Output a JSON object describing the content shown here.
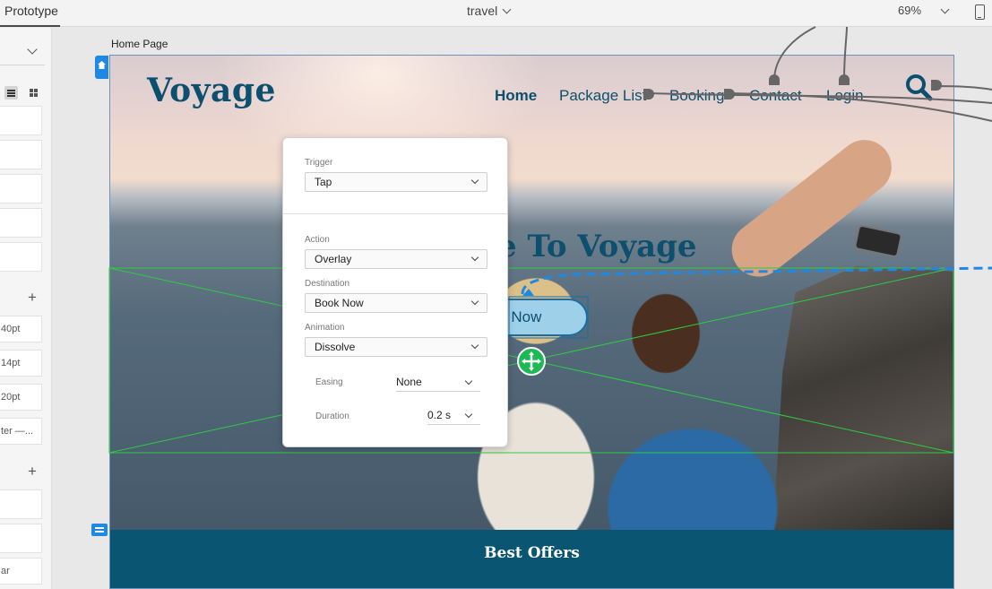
{
  "toolbar": {
    "mode": "Prototype",
    "document_title": "travel",
    "zoom": "69%",
    "device_icon": "mobile-device-icon"
  },
  "left_panel": {
    "field_values": [
      "40pt",
      "14pt",
      "20pt",
      "ter —...",
      "ar"
    ]
  },
  "canvas": {
    "artboard_label": "Home Page"
  },
  "site": {
    "logo": "Voyage",
    "nav": [
      "Home",
      "Package List",
      "Booking",
      "Contact",
      "Login"
    ],
    "hero_title": "e To Voyage",
    "book_button": "ok Now",
    "offers_heading": "Best Offers"
  },
  "interaction": {
    "trigger_label": "Trigger",
    "trigger_value": "Tap",
    "action_label": "Action",
    "action_value": "Overlay",
    "destination_label": "Destination",
    "destination_value": "Book Now",
    "animation_label": "Animation",
    "animation_value": "Dissolve",
    "easing_label": "Easing",
    "easing_value": "None",
    "duration_label": "Duration",
    "duration_value": "0.2 s"
  },
  "colors": {
    "brand": "#0d4f6e",
    "wire_blue": "#1e88e5",
    "overlay_green": "#2ecc40",
    "offers_bg": "#0a5571"
  }
}
